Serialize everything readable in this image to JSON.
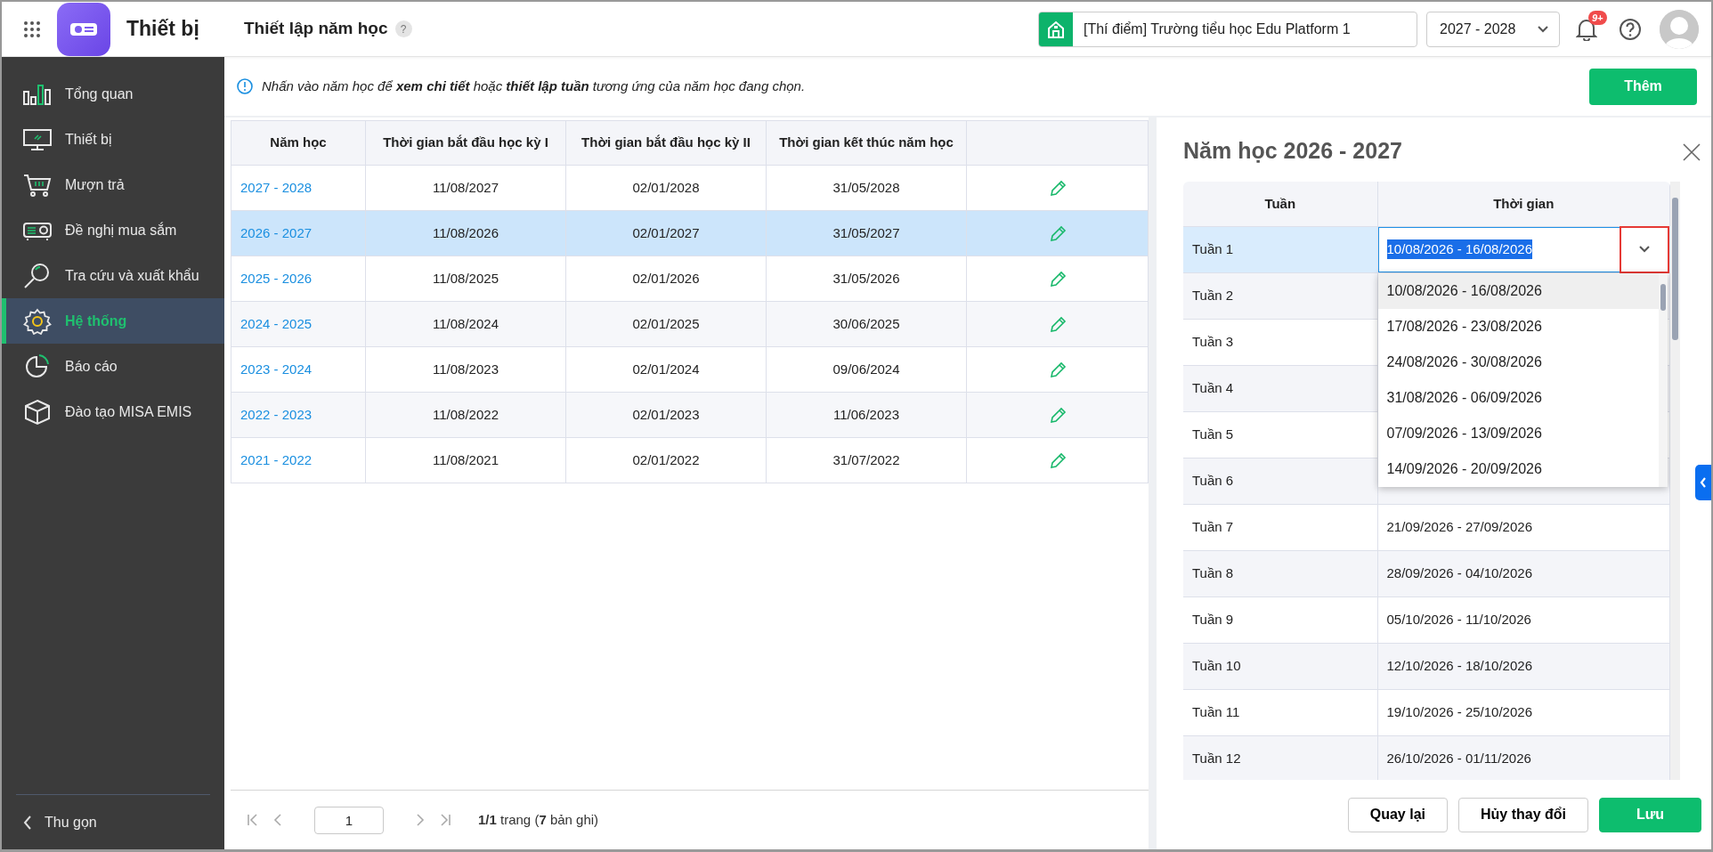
{
  "app": {
    "name": "Thiết bị"
  },
  "header": {
    "title": "Thiết lập năm học",
    "help": "?",
    "school": "[Thí điểm] Trường tiểu học Edu Platform 1",
    "year": "2027 - 2028",
    "notifications": "9+"
  },
  "sidebar": {
    "items": [
      {
        "label": "Tổng quan",
        "selected": false
      },
      {
        "label": "Thiết bị",
        "selected": false
      },
      {
        "label": "Mượn trả",
        "selected": false
      },
      {
        "label": "Đề nghị mua sắm",
        "selected": false
      },
      {
        "label": "Tra cứu và xuất khẩu",
        "selected": false
      },
      {
        "label": "Hệ thống",
        "selected": true
      },
      {
        "label": "Báo cáo",
        "selected": false
      },
      {
        "label": "Đào tạo MISA EMIS",
        "selected": false
      }
    ],
    "collapse": "Thu gọn"
  },
  "notice": "Nhấn vào năm học để **xem chi tiết** hoặc **thiết lập tuần** tương ứng của năm học đang chọn.",
  "add_button": "Thêm",
  "years_table": {
    "columns": [
      "Năm học",
      "Thời gian bắt đầu học kỳ I",
      "Thời gian bắt đầu học kỳ II",
      "Thời gian kết thúc năm học"
    ],
    "rows": [
      {
        "year": "2027 - 2028",
        "start_1": "11/08/2027",
        "start_2": "02/01/2028",
        "end": "31/05/2028",
        "selected": false
      },
      {
        "year": "2026 - 2027",
        "start_1": "11/08/2026",
        "start_2": "02/01/2027",
        "end": "31/05/2027",
        "selected": true
      },
      {
        "year": "2025 - 2026",
        "start_1": "11/08/2025",
        "start_2": "02/01/2026",
        "end": "31/05/2026",
        "selected": false
      },
      {
        "year": "2024 - 2025",
        "start_1": "11/08/2024",
        "start_2": "02/01/2025",
        "end": "30/06/2025",
        "selected": false
      },
      {
        "year": "2023 - 2024",
        "start_1": "11/08/2023",
        "start_2": "02/01/2024",
        "end": "09/06/2024",
        "selected": false
      },
      {
        "year": "2022 - 2023",
        "start_1": "11/08/2022",
        "start_2": "02/01/2023",
        "end": "11/06/2023",
        "selected": false
      },
      {
        "year": "2021 - 2022",
        "start_1": "11/08/2021",
        "start_2": "02/01/2022",
        "end": "31/07/2022",
        "selected": false
      }
    ]
  },
  "pagination": {
    "page": "1",
    "summary": "**1/1** trang (**7** bản ghi)"
  },
  "detail": {
    "title": "Năm học 2026 - 2027",
    "columns": [
      "Tuần",
      "Thời gian"
    ],
    "weeks": [
      {
        "week": "Tuần 1",
        "time": "10/08/2026 - 16/08/2026",
        "selected": true
      },
      {
        "week": "Tuần 2",
        "selected": false
      },
      {
        "week": "Tuần 3",
        "selected": false
      },
      {
        "week": "Tuần 4",
        "selected": false
      },
      {
        "week": "Tuần 5",
        "selected": false
      },
      {
        "week": "Tuần 6",
        "selected": false
      },
      {
        "week": "Tuần 7",
        "time": "21/09/2026 - 27/09/2026",
        "selected": false
      },
      {
        "week": "Tuần 8",
        "time": "28/09/2026 - 04/10/2026",
        "selected": false
      },
      {
        "week": "Tuần 9",
        "time": "05/10/2026 - 11/10/2026",
        "selected": false
      },
      {
        "week": "Tuần 10",
        "time": "12/10/2026 - 18/10/2026",
        "selected": false
      },
      {
        "week": "Tuần 11",
        "time": "19/10/2026 - 25/10/2026",
        "selected": false
      },
      {
        "week": "Tuần 12",
        "time": "26/10/2026 - 01/11/2026",
        "selected": false
      }
    ],
    "dropdown": {
      "options": [
        {
          "label": "10/08/2026 - 16/08/2026",
          "selected": true
        },
        {
          "label": "17/08/2026 - 23/08/2026",
          "selected": false
        },
        {
          "label": "24/08/2026 - 30/08/2026",
          "selected": false
        },
        {
          "label": "31/08/2026 - 06/09/2026",
          "selected": false
        },
        {
          "label": "07/09/2026 - 13/09/2026",
          "selected": false
        },
        {
          "label": "14/09/2026 - 20/09/2026",
          "selected": false
        }
      ]
    },
    "buttons": [
      {
        "label": "Quay lại",
        "kind": "secondary"
      },
      {
        "label": "Hủy thay đổi",
        "kind": "secondary"
      },
      {
        "label": "Lưu",
        "kind": "primary"
      }
    ]
  }
}
